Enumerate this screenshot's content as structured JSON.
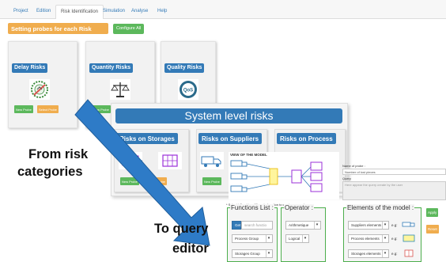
{
  "tabs": [
    "Project",
    "Edition",
    "Risk Identification",
    "Simulation",
    "Analyse",
    "Help"
  ],
  "page": {
    "title": "Setting probes for each Risk",
    "configure_label": "Configure All"
  },
  "categories": [
    {
      "name": "Delay Risks",
      "new_probe": "New Probe",
      "select_probe": "Select Probe",
      "icon": "delay-seal-icon"
    },
    {
      "name": "Quantity Risks",
      "new_probe": "New Probe",
      "icon": "scale-icon"
    },
    {
      "name": "Quality Risks",
      "icon": "qos-icon",
      "icon_text": "QoS"
    }
  ],
  "system": {
    "title": "System level risks",
    "cards": [
      {
        "name": "Risks on Storages",
        "new_probe": "New Probe",
        "select_probe": "Select Probe"
      },
      {
        "name": "Risks on Suppliers",
        "new_probe": "New Probe"
      },
      {
        "name": "Risks on Process"
      }
    ]
  },
  "model": {
    "title": "VIEW OF THE MODEL"
  },
  "probe_form": {
    "name_label": "Name of probe :",
    "name_value": "Number of lost pieces",
    "query_label": "Query",
    "query_placeholder": "Here appear the query create by the user"
  },
  "editor": {
    "note": "* Select / Combine differente function to create new probe",
    "functions_label": "Functions List :",
    "get_label": "Get",
    "search_placeholder": "search functio",
    "process_group": "Process Group",
    "storages_group": "Storages Group",
    "operator_label": "Operator :",
    "arithmetique": "Arithmetique",
    "logical": "Logical",
    "elements_label": "Elements of the model :",
    "suppliers_elements": "Suppliers elements",
    "process_elements": "Process elements",
    "storages_elements": "Storages elements",
    "eg": "e.g:",
    "apply_label": "Apply",
    "reset_label": "Reset"
  },
  "annotations": {
    "from_line1": "From risk",
    "from_line2": "categories",
    "to_line1": "To query",
    "to_line2": "editor"
  },
  "colors": {
    "primary": "#337ab7",
    "orange": "#f0ad4e",
    "green": "#5cb85c",
    "purple": "#9b30d9"
  }
}
